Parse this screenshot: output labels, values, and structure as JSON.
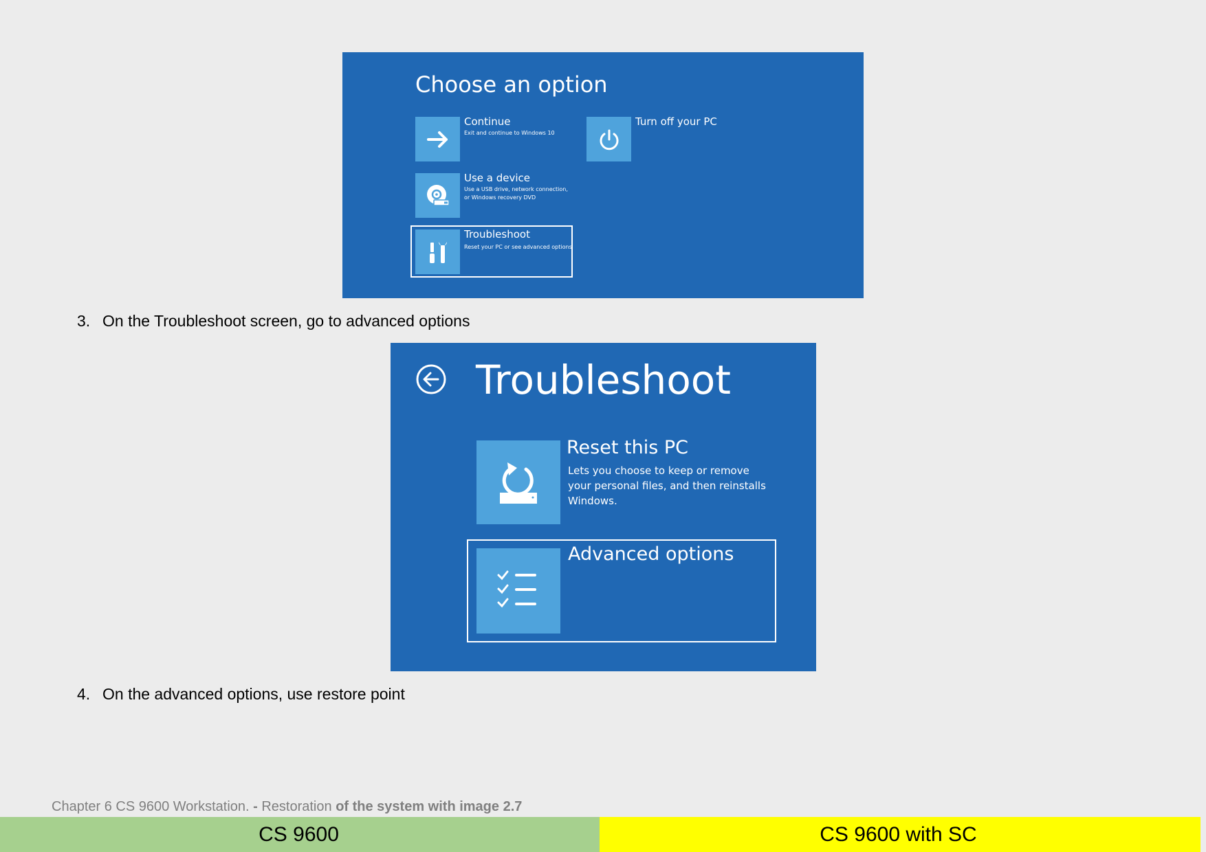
{
  "screen1": {
    "title": "Choose an option",
    "continue_title": "Continue",
    "continue_desc": "Exit and continue to Windows 10",
    "turnoff_title": "Turn off your PC",
    "device_title": "Use a device",
    "device_desc_1": "Use a USB drive, network connection,",
    "device_desc_2": "or Windows recovery DVD",
    "troubleshoot_title": "Troubleshoot",
    "troubleshoot_desc": "Reset your PC or see advanced options"
  },
  "steps": [
    {
      "number": "3.",
      "text": "On the Troubleshoot screen, go to advanced options"
    },
    {
      "number": "4.",
      "text": "On the advanced options, use restore point"
    }
  ],
  "screen2": {
    "title": "Troubleshoot",
    "reset_title": "Reset this PC",
    "reset_desc_1": "Lets you choose to keep or remove",
    "reset_desc_2": "your personal files, and then reinstalls",
    "reset_desc_3": "Windows.",
    "advanced_title": "Advanced options"
  },
  "footer": {
    "chapter_prefix": "Chapter 6 CS 9600 Workstation. ",
    "chapter_dash": "- ",
    "chapter_mid": "Restoration ",
    "chapter_bold": "of the system with image 2.7",
    "left_band": "CS 9600",
    "right_band": "CS 9600 with SC"
  },
  "colors": {
    "screen_blue": "#2068b4",
    "tile_blue": "#4fa3dc",
    "page_bg": "#ececec",
    "band_green": "#a6d08e",
    "band_yellow": "#ffff00"
  }
}
